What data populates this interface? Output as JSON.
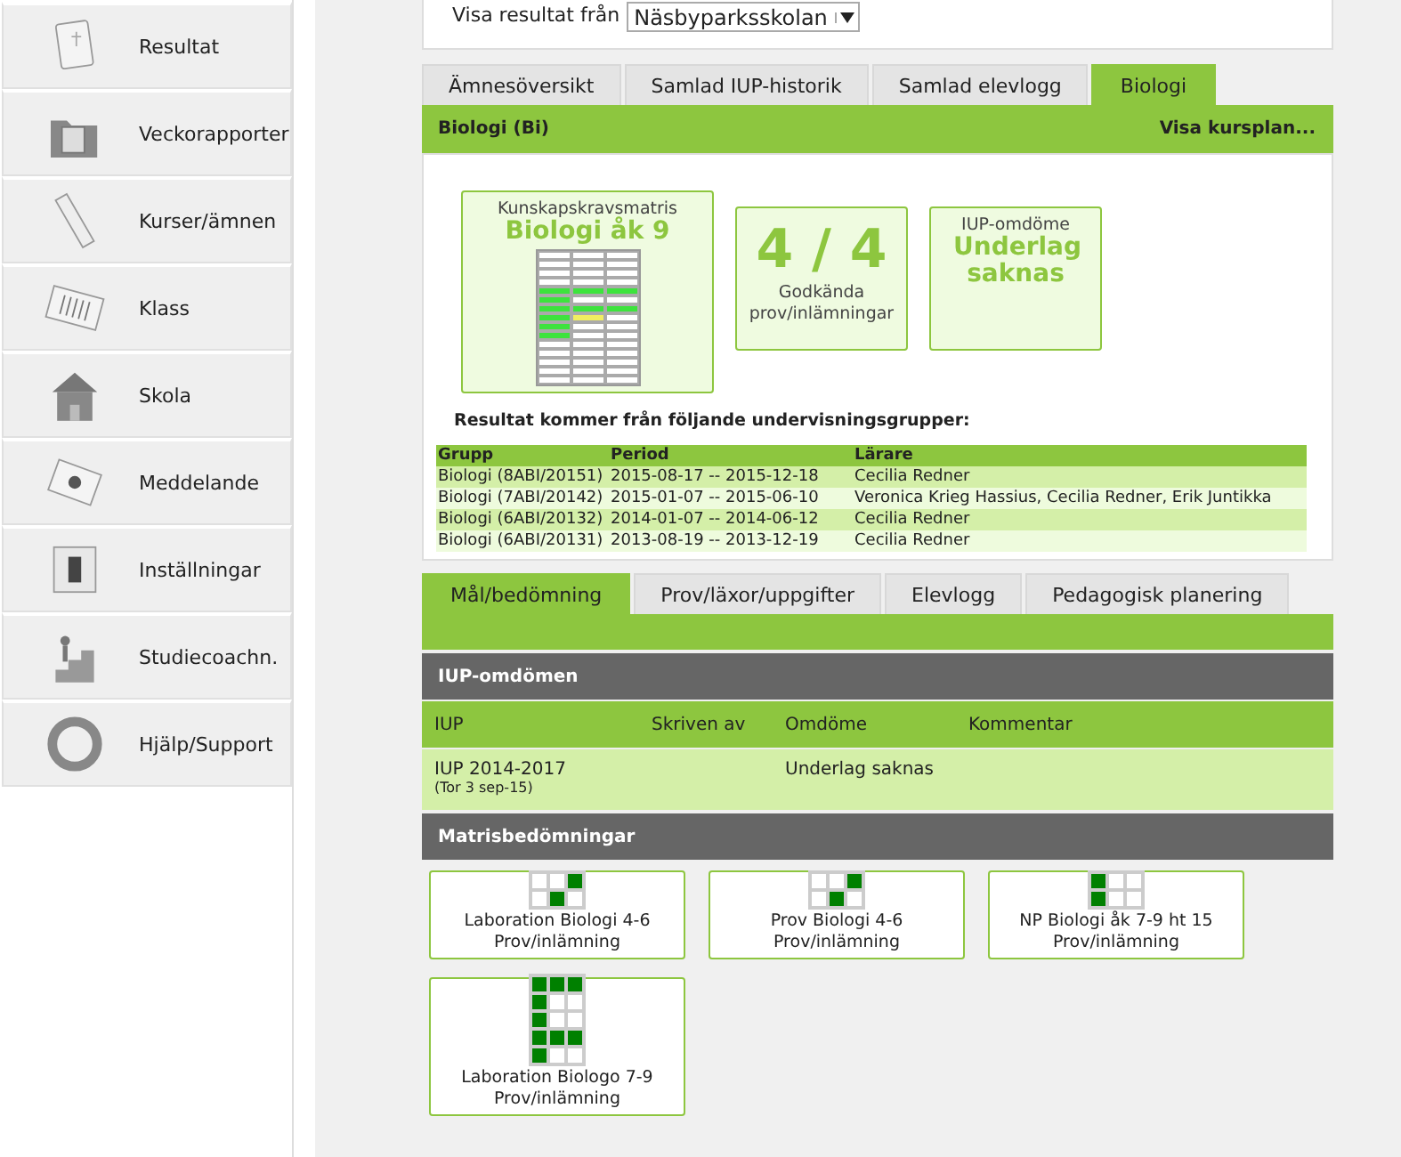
{
  "sidebar": {
    "items": [
      {
        "label": "Resultat"
      },
      {
        "label": "Veckorapporter"
      },
      {
        "label": "Kurser/ämnen"
      },
      {
        "label": "Klass"
      },
      {
        "label": "Skola"
      },
      {
        "label": "Meddelande"
      },
      {
        "label": "Inställningar"
      },
      {
        "label": "Studiecoachn."
      },
      {
        "label": "Hjälp/Support"
      }
    ]
  },
  "filter": {
    "label": "Visa resultat från",
    "value": "Näsbyparksskolan"
  },
  "tabs": [
    {
      "label": "Ämnesöversikt",
      "selected": false
    },
    {
      "label": "Samlad IUP-historik",
      "selected": false
    },
    {
      "label": "Samlad elevlogg",
      "selected": false
    },
    {
      "label": "Biologi",
      "selected": true
    }
  ],
  "subject_bar": {
    "title": "Biologi (Bi)",
    "link": "Visa kursplan..."
  },
  "summary": {
    "matrix_card": {
      "caption": "Kunskapskravsmatris",
      "title": "Biologi åk 9",
      "grid": [
        [
          {
            "color": "#ffffff"
          },
          {
            "color": "#ffffff"
          },
          {
            "color": "#ffffff"
          }
        ],
        [
          {
            "color": "#ffffff"
          },
          {
            "color": "#ffffff"
          },
          {
            "color": "#ffffff"
          }
        ],
        [
          {
            "color": "#ffffff"
          },
          {
            "color": "#ffffff"
          },
          {
            "color": "#ffffff"
          }
        ],
        [
          {
            "color": "#ffffff"
          },
          {
            "color": "#ffffff"
          },
          {
            "color": "#ffffff"
          }
        ],
        [
          {
            "color": "#3de33d"
          },
          {
            "color": "#3de33d"
          },
          {
            "color": "#3de33d"
          }
        ],
        [
          {
            "color": "#3de33d"
          },
          {
            "color": "#ffffff"
          },
          {
            "color": "#ffffff"
          }
        ],
        [
          {
            "color": "#3de33d"
          },
          {
            "color": "#3de33d"
          },
          {
            "color": "#3de33d"
          }
        ],
        [
          {
            "color": "#3de33d"
          },
          {
            "color": "#f0ee60"
          },
          {
            "color": "#ffffff"
          }
        ],
        [
          {
            "color": "#3de33d"
          },
          {
            "color": "#ffffff"
          },
          {
            "color": "#ffffff"
          }
        ],
        [
          {
            "color": "#3de33d"
          },
          {
            "color": "#ffffff"
          },
          {
            "color": "#ffffff"
          }
        ],
        [
          {
            "color": "#ffffff"
          },
          {
            "color": "#ffffff"
          },
          {
            "color": "#ffffff"
          }
        ],
        [
          {
            "color": "#ffffff"
          },
          {
            "color": "#ffffff"
          },
          {
            "color": "#ffffff"
          }
        ],
        [
          {
            "color": "#ffffff"
          },
          {
            "color": "#ffffff"
          },
          {
            "color": "#ffffff"
          }
        ],
        [
          {
            "color": "#ffffff"
          },
          {
            "color": "#ffffff"
          },
          {
            "color": "#ffffff"
          }
        ],
        [
          {
            "color": "#ffffff"
          },
          {
            "color": "#ffffff"
          },
          {
            "color": "#ffffff"
          }
        ]
      ]
    },
    "count_card": {
      "value": "4 / 4",
      "caption": "Godkända prov/inlämningar"
    },
    "iup_card": {
      "caption": "IUP-omdöme",
      "value": "Underlag saknas"
    }
  },
  "groups": {
    "intro": "Resultat kommer från följande undervisningsgrupper:",
    "columns": [
      "Grupp",
      "Period",
      "Lärare"
    ],
    "rows": [
      [
        "Biologi (8ABI/20151)",
        "2015-08-17 -- 2015-12-18",
        "Cecilia Redner"
      ],
      [
        "Biologi (7ABI/20142)",
        "2015-01-07 -- 2015-06-10",
        "Veronica Krieg Hassius, Cecilia Redner, Erik Juntikka"
      ],
      [
        "Biologi (6ABI/20132)",
        "2014-01-07 -- 2014-06-12",
        "Cecilia Redner"
      ],
      [
        "Biologi (6ABI/20131)",
        "2013-08-19 -- 2013-12-19",
        "Cecilia Redner"
      ]
    ]
  },
  "subtabs": [
    {
      "label": "Mål/bedömning",
      "selected": true
    },
    {
      "label": "Prov/läxor/uppgifter",
      "selected": false
    },
    {
      "label": "Elevlogg",
      "selected": false
    },
    {
      "label": "Pedagogisk planering",
      "selected": false
    }
  ],
  "iup": {
    "title": "IUP-omdömen",
    "columns": [
      "IUP",
      "Skriven av",
      "Omdöme",
      "Kommentar"
    ],
    "rows": [
      {
        "iup": "IUP 2014-2017",
        "date": "(Tor 3 sep-15)",
        "omdome": "Underlag saknas"
      }
    ]
  },
  "matrix_assessments": {
    "title": "Matrisbedömningar",
    "cards": [
      {
        "name": "Laboration Biologi 4-6",
        "type": "Prov/inlämning",
        "grid": [
          [
            false,
            false,
            true
          ],
          [
            false,
            true,
            false
          ]
        ]
      },
      {
        "name": "Prov Biologi 4-6",
        "type": "Prov/inlämning",
        "grid": [
          [
            false,
            false,
            true
          ],
          [
            false,
            true,
            false
          ]
        ]
      },
      {
        "name": "NP Biologi åk 7-9 ht 15",
        "type": "Prov/inlämning",
        "grid": [
          [
            true,
            false,
            false
          ],
          [
            true,
            false,
            false
          ]
        ]
      },
      {
        "name": "Laboration Biologo 7-9",
        "type": "Prov/inlämning",
        "grid": [
          [
            true,
            true,
            true
          ],
          [
            true,
            false,
            false
          ],
          [
            true,
            false,
            false
          ],
          [
            true,
            true,
            true
          ],
          [
            true,
            false,
            false
          ]
        ]
      }
    ]
  }
}
